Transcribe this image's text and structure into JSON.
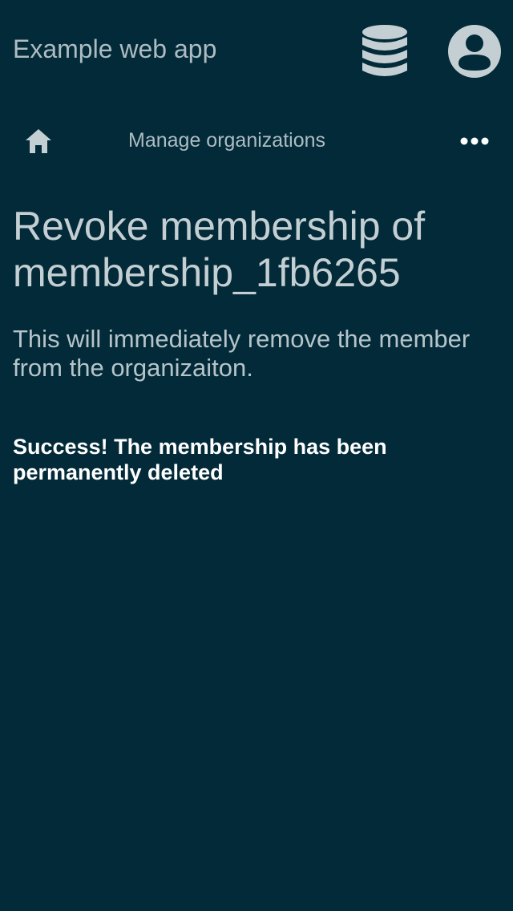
{
  "header": {
    "app_title": "Example web app"
  },
  "nav": {
    "title": "Manage organizations"
  },
  "main": {
    "title": "Revoke membership of membership_1fb6265",
    "description": "This will immediately remove the member from the organizaiton.",
    "success_message": "Success! The membership has been permanently deleted"
  },
  "icons": {
    "database": "database-icon",
    "account": "account-circle-icon",
    "home": "home-icon",
    "more": "more-horizontal-icon"
  },
  "colors": {
    "background": "#022a38",
    "icon": "#c4cfd3",
    "text_muted": "#aebcc2",
    "success_text": "#ffffff"
  }
}
